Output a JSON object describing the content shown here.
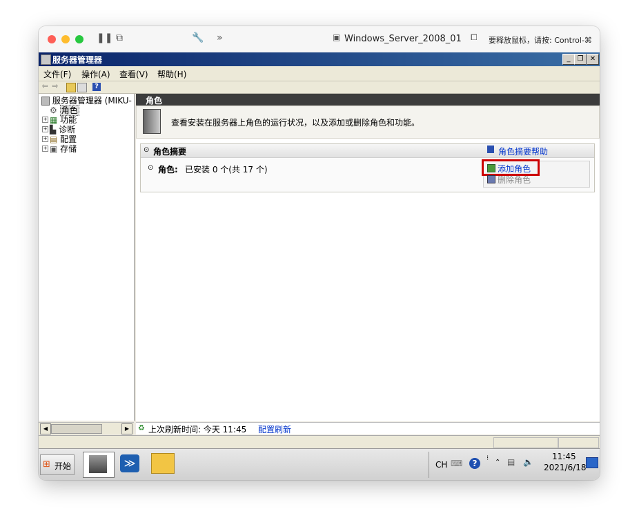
{
  "mac": {
    "title": "Windows_Server_2008_01",
    "hint": "要释放鼠标，请按: Control-⌘"
  },
  "window": {
    "title": "服务器管理器"
  },
  "menubar": [
    "文件(F)",
    "操作(A)",
    "查看(V)",
    "帮助(H)"
  ],
  "tree": {
    "root": "服务器管理器 (MIKU-",
    "items": [
      {
        "label": "角色",
        "selected": true
      },
      {
        "label": "功能",
        "selected": false
      },
      {
        "label": "诊断",
        "selected": false
      },
      {
        "label": "配置",
        "selected": false
      },
      {
        "label": "存储",
        "selected": false
      }
    ]
  },
  "main": {
    "header": "角色",
    "description": "查看安装在服务器上角色的运行状况，以及添加或删除角色和功能。",
    "summary_title": "角色摘要",
    "summary_help": "角色摘要帮助",
    "roles_label": "角色:",
    "roles_status": "已安装 0 个(共 17 个)",
    "add_roles": "添加角色",
    "remove_roles": "删除角色"
  },
  "status": {
    "refresh_text": "上次刷新时间: 今天 11:45",
    "configure_refresh": "配置刷新"
  },
  "taskbar": {
    "start": "开始",
    "lang": "CH",
    "time": "11:45",
    "date": "2021/6/18"
  },
  "colors": {
    "highlight_box": "#cc0000",
    "link": "#0033cc"
  }
}
